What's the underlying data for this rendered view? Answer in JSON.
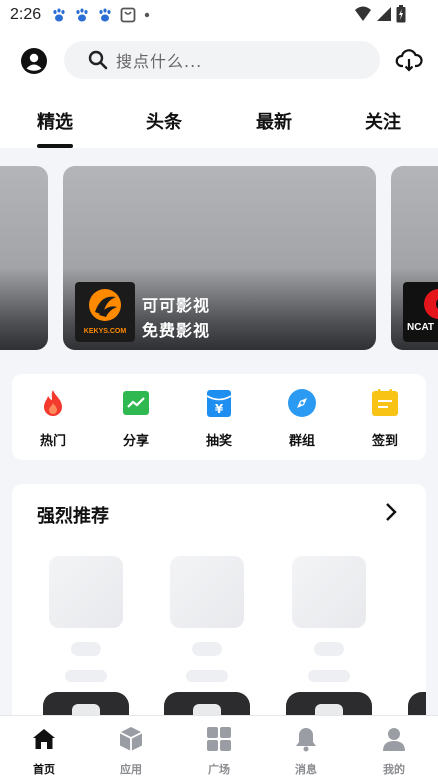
{
  "status_bar": {
    "time": "2:26",
    "icons": [
      "paw-icon",
      "paw-icon",
      "paw-icon",
      "shopping-bag-icon",
      "dot-icon",
      "wifi-icon",
      "signal-icon",
      "battery-charging-icon"
    ]
  },
  "header": {
    "avatar_icon": "user-icon",
    "search_placeholder": "搜点什么...",
    "search_icon": "search-icon",
    "download_icon": "cloud-download-icon"
  },
  "tabs": [
    {
      "label": "精选",
      "active": true
    },
    {
      "label": "头条",
      "active": false
    },
    {
      "label": "最新",
      "active": false
    },
    {
      "label": "关注",
      "active": false
    }
  ],
  "carousel": {
    "slides": [
      {
        "title": "可可影视",
        "subtitle": "免费影视",
        "logo_caption": "KEKYS.COM"
      },
      {
        "logo_caption": "NCAT"
      }
    ]
  },
  "quick_nav": [
    {
      "label": "热门",
      "icon": "fire-icon",
      "color": "#f23a2f"
    },
    {
      "label": "分享",
      "icon": "trend-chart-icon",
      "color": "#2eb84f"
    },
    {
      "label": "抽奖",
      "icon": "yen-envelope-icon",
      "color": "#1e8ef0"
    },
    {
      "label": "群组",
      "icon": "compass-icon",
      "color": "#2b9af3"
    },
    {
      "label": "签到",
      "icon": "notepad-icon",
      "color": "#f8c315"
    }
  ],
  "recommend": {
    "title": "强烈推荐",
    "more_icon": "chevron-right-icon"
  },
  "bottom_nav": [
    {
      "label": "首页",
      "icon": "home-icon",
      "active": true
    },
    {
      "label": "应用",
      "icon": "box-icon",
      "active": false
    },
    {
      "label": "广场",
      "icon": "grid-icon",
      "active": false
    },
    {
      "label": "消息",
      "icon": "bell-icon",
      "active": false
    },
    {
      "label": "我的",
      "icon": "person-icon",
      "active": false
    }
  ]
}
